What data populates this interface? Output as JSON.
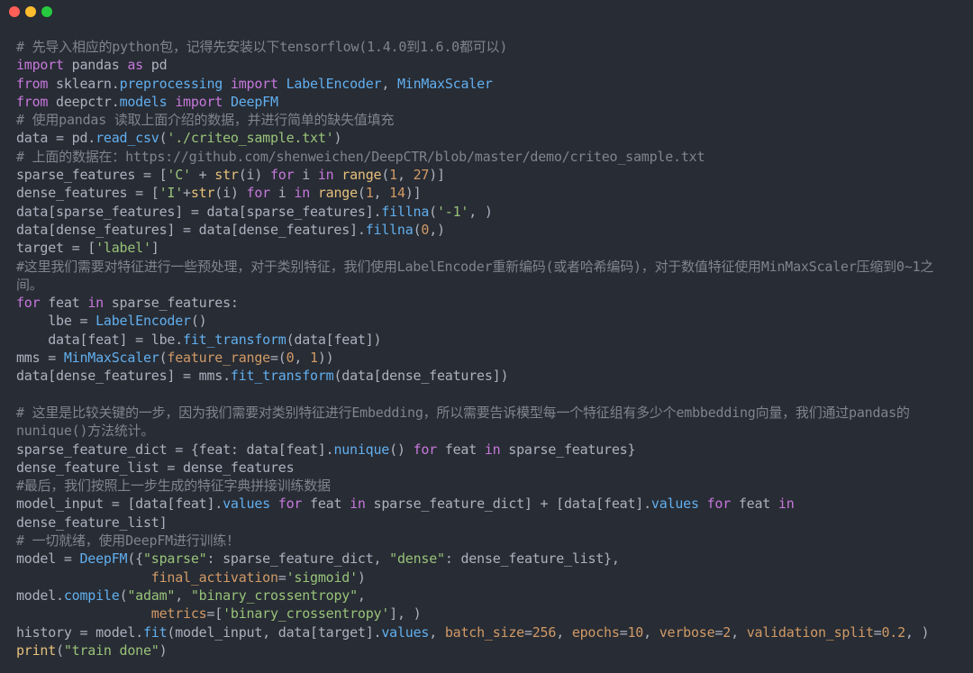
{
  "window": {
    "buttons": [
      "close-button",
      "minimize-button",
      "maximize-button"
    ],
    "colors": {
      "close": "#ff5f56",
      "minimize": "#ffbd2e",
      "maximize": "#27c93f",
      "background": "#282c34"
    }
  },
  "code": {
    "lines": [
      [
        {
          "t": "c",
          "v": "# 先导入相应的python包，记得先安装以下tensorflow(1.4.0到1.6.0都可以)"
        }
      ],
      [
        {
          "t": "k",
          "v": "import"
        },
        {
          "t": "v",
          "v": " pandas "
        },
        {
          "t": "k",
          "v": "as"
        },
        {
          "t": "v",
          "v": " pd"
        }
      ],
      [
        {
          "t": "k",
          "v": "from"
        },
        {
          "t": "v",
          "v": " sklearn."
        },
        {
          "t": "f",
          "v": "preprocessing"
        },
        {
          "t": "v",
          "v": " "
        },
        {
          "t": "k",
          "v": "import"
        },
        {
          "t": "v",
          "v": " "
        },
        {
          "t": "f",
          "v": "LabelEncoder"
        },
        {
          "t": "v",
          "v": ", "
        },
        {
          "t": "f",
          "v": "MinMaxScaler"
        }
      ],
      [
        {
          "t": "k",
          "v": "from"
        },
        {
          "t": "v",
          "v": " deepctr."
        },
        {
          "t": "f",
          "v": "models"
        },
        {
          "t": "v",
          "v": " "
        },
        {
          "t": "k",
          "v": "import"
        },
        {
          "t": "v",
          "v": " "
        },
        {
          "t": "f",
          "v": "DeepFM"
        }
      ],
      [
        {
          "t": "c",
          "v": "# 使用pandas 读取上面介绍的数据，并进行简单的缺失值填充"
        }
      ],
      [
        {
          "t": "v",
          "v": "data = pd."
        },
        {
          "t": "f",
          "v": "read_csv"
        },
        {
          "t": "v",
          "v": "("
        },
        {
          "t": "s",
          "v": "'./criteo_sample.txt'"
        },
        {
          "t": "v",
          "v": ")"
        }
      ],
      [
        {
          "t": "c",
          "v": "# 上面的数据在：https://github.com/shenweichen/DeepCTR/blob/master/demo/criteo_sample.txt"
        }
      ],
      [
        {
          "t": "v",
          "v": "sparse_features = ["
        },
        {
          "t": "s",
          "v": "'C'"
        },
        {
          "t": "v",
          "v": " + "
        },
        {
          "t": "b",
          "v": "str"
        },
        {
          "t": "v",
          "v": "(i) "
        },
        {
          "t": "k",
          "v": "for"
        },
        {
          "t": "v",
          "v": " i "
        },
        {
          "t": "k",
          "v": "in"
        },
        {
          "t": "v",
          "v": " "
        },
        {
          "t": "b",
          "v": "range"
        },
        {
          "t": "v",
          "v": "("
        },
        {
          "t": "n",
          "v": "1"
        },
        {
          "t": "v",
          "v": ", "
        },
        {
          "t": "n",
          "v": "27"
        },
        {
          "t": "v",
          "v": ")]"
        }
      ],
      [
        {
          "t": "v",
          "v": "dense_features = ["
        },
        {
          "t": "s",
          "v": "'I'"
        },
        {
          "t": "v",
          "v": "+"
        },
        {
          "t": "b",
          "v": "str"
        },
        {
          "t": "v",
          "v": "(i) "
        },
        {
          "t": "k",
          "v": "for"
        },
        {
          "t": "v",
          "v": " i "
        },
        {
          "t": "k",
          "v": "in"
        },
        {
          "t": "v",
          "v": " "
        },
        {
          "t": "b",
          "v": "range"
        },
        {
          "t": "v",
          "v": "("
        },
        {
          "t": "n",
          "v": "1"
        },
        {
          "t": "v",
          "v": ", "
        },
        {
          "t": "n",
          "v": "14"
        },
        {
          "t": "v",
          "v": ")]"
        }
      ],
      [
        {
          "t": "v",
          "v": "data[sparse_features] = data[sparse_features]."
        },
        {
          "t": "f",
          "v": "fillna"
        },
        {
          "t": "v",
          "v": "("
        },
        {
          "t": "s",
          "v": "'-1'"
        },
        {
          "t": "v",
          "v": ", )"
        }
      ],
      [
        {
          "t": "v",
          "v": "data[dense_features] = data[dense_features]."
        },
        {
          "t": "f",
          "v": "fillna"
        },
        {
          "t": "v",
          "v": "("
        },
        {
          "t": "n",
          "v": "0"
        },
        {
          "t": "v",
          "v": ",)"
        }
      ],
      [
        {
          "t": "v",
          "v": "target = ["
        },
        {
          "t": "s",
          "v": "'label'"
        },
        {
          "t": "v",
          "v": "]"
        }
      ],
      [
        {
          "t": "c",
          "v": "#这里我们需要对特征进行一些预处理，对于类别特征，我们使用LabelEncoder重新编码(或者哈希编码)，对于数值特征使用MinMaxScaler压缩到0~1之"
        }
      ],
      [
        {
          "t": "c",
          "v": "间。"
        }
      ],
      [
        {
          "t": "k",
          "v": "for"
        },
        {
          "t": "v",
          "v": " feat "
        },
        {
          "t": "k",
          "v": "in"
        },
        {
          "t": "v",
          "v": " sparse_features:"
        }
      ],
      [
        {
          "t": "v",
          "v": "    lbe = "
        },
        {
          "t": "f",
          "v": "LabelEncoder"
        },
        {
          "t": "v",
          "v": "()"
        }
      ],
      [
        {
          "t": "v",
          "v": "    data[feat] = lbe."
        },
        {
          "t": "f",
          "v": "fit_transform"
        },
        {
          "t": "v",
          "v": "(data[feat])"
        }
      ],
      [
        {
          "t": "v",
          "v": "mms = "
        },
        {
          "t": "f",
          "v": "MinMaxScaler"
        },
        {
          "t": "v",
          "v": "("
        },
        {
          "t": "n",
          "v": "feature_range"
        },
        {
          "t": "v",
          "v": "=("
        },
        {
          "t": "n",
          "v": "0"
        },
        {
          "t": "v",
          "v": ", "
        },
        {
          "t": "n",
          "v": "1"
        },
        {
          "t": "v",
          "v": "))"
        }
      ],
      [
        {
          "t": "v",
          "v": "data[dense_features] = mms."
        },
        {
          "t": "f",
          "v": "fit_transform"
        },
        {
          "t": "v",
          "v": "(data[dense_features])"
        }
      ],
      [],
      [
        {
          "t": "c",
          "v": "# 这里是比较关键的一步，因为我们需要对类别特征进行Embedding，所以需要告诉模型每一个特征组有多少个embbedding向量，我们通过pandas的"
        }
      ],
      [
        {
          "t": "c",
          "v": "nunique()方法统计。"
        }
      ],
      [
        {
          "t": "v",
          "v": "sparse_feature_dict = {feat: data[feat]."
        },
        {
          "t": "f",
          "v": "nunique"
        },
        {
          "t": "v",
          "v": "() "
        },
        {
          "t": "k",
          "v": "for"
        },
        {
          "t": "v",
          "v": " feat "
        },
        {
          "t": "k",
          "v": "in"
        },
        {
          "t": "v",
          "v": " sparse_features}"
        }
      ],
      [
        {
          "t": "v",
          "v": "dense_feature_list = dense_features"
        }
      ],
      [
        {
          "t": "c",
          "v": "#最后，我们按照上一步生成的特征字典拼接训练数据"
        }
      ],
      [
        {
          "t": "v",
          "v": "model_input = [data[feat]."
        },
        {
          "t": "f",
          "v": "values"
        },
        {
          "t": "v",
          "v": " "
        },
        {
          "t": "k",
          "v": "for"
        },
        {
          "t": "v",
          "v": " feat "
        },
        {
          "t": "k",
          "v": "in"
        },
        {
          "t": "v",
          "v": " sparse_feature_dict] + [data[feat]."
        },
        {
          "t": "f",
          "v": "values"
        },
        {
          "t": "v",
          "v": " "
        },
        {
          "t": "k",
          "v": "for"
        },
        {
          "t": "v",
          "v": " feat "
        },
        {
          "t": "k",
          "v": "in"
        }
      ],
      [
        {
          "t": "v",
          "v": "dense_feature_list]"
        }
      ],
      [
        {
          "t": "c",
          "v": "# 一切就绪，使用DeepFM进行训练！"
        }
      ],
      [
        {
          "t": "v",
          "v": "model = "
        },
        {
          "t": "f",
          "v": "DeepFM"
        },
        {
          "t": "v",
          "v": "({"
        },
        {
          "t": "s",
          "v": "\"sparse\""
        },
        {
          "t": "v",
          "v": ": sparse_feature_dict, "
        },
        {
          "t": "s",
          "v": "\"dense\""
        },
        {
          "t": "v",
          "v": ": dense_feature_list},"
        }
      ],
      [
        {
          "t": "v",
          "v": "                 "
        },
        {
          "t": "n",
          "v": "final_activation"
        },
        {
          "t": "v",
          "v": "="
        },
        {
          "t": "s",
          "v": "'sigmoid'"
        },
        {
          "t": "v",
          "v": ")"
        }
      ],
      [
        {
          "t": "v",
          "v": "model."
        },
        {
          "t": "f",
          "v": "compile"
        },
        {
          "t": "v",
          "v": "("
        },
        {
          "t": "s",
          "v": "\"adam\""
        },
        {
          "t": "v",
          "v": ", "
        },
        {
          "t": "s",
          "v": "\"binary_crossentropy\""
        },
        {
          "t": "v",
          "v": ","
        }
      ],
      [
        {
          "t": "v",
          "v": "                 "
        },
        {
          "t": "n",
          "v": "metrics"
        },
        {
          "t": "v",
          "v": "=["
        },
        {
          "t": "s",
          "v": "'binary_crossentropy'"
        },
        {
          "t": "v",
          "v": "], )"
        }
      ],
      [
        {
          "t": "v",
          "v": "history = model."
        },
        {
          "t": "f",
          "v": "fit"
        },
        {
          "t": "v",
          "v": "(model_input, data[target]."
        },
        {
          "t": "f",
          "v": "values"
        },
        {
          "t": "v",
          "v": ", "
        },
        {
          "t": "n",
          "v": "batch_size"
        },
        {
          "t": "v",
          "v": "="
        },
        {
          "t": "n",
          "v": "256"
        },
        {
          "t": "v",
          "v": ", "
        },
        {
          "t": "n",
          "v": "epochs"
        },
        {
          "t": "v",
          "v": "="
        },
        {
          "t": "n",
          "v": "10"
        },
        {
          "t": "v",
          "v": ", "
        },
        {
          "t": "n",
          "v": "verbose"
        },
        {
          "t": "v",
          "v": "="
        },
        {
          "t": "n",
          "v": "2"
        },
        {
          "t": "v",
          "v": ", "
        },
        {
          "t": "n",
          "v": "validation_split"
        },
        {
          "t": "v",
          "v": "="
        },
        {
          "t": "n",
          "v": "0.2"
        },
        {
          "t": "v",
          "v": ", )"
        }
      ],
      [
        {
          "t": "b",
          "v": "print"
        },
        {
          "t": "v",
          "v": "("
        },
        {
          "t": "s",
          "v": "\"train done\""
        },
        {
          "t": "v",
          "v": ")"
        }
      ]
    ]
  }
}
